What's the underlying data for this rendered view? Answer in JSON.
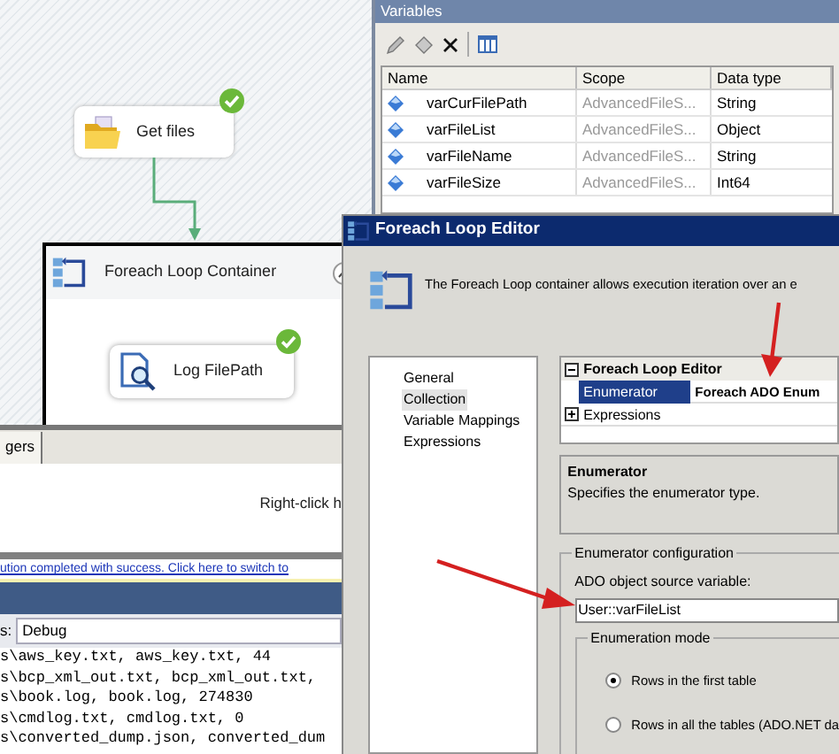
{
  "designer": {
    "task": {
      "label": "Get files",
      "succeeded": true
    },
    "container": {
      "title": "Foreach Loop Container",
      "expanded": true,
      "children": [
        {
          "label": "Log FilePath",
          "succeeded": true
        }
      ]
    }
  },
  "variables": {
    "title": "Variables",
    "columns": [
      "Name",
      "Scope",
      "Data type"
    ],
    "rows": [
      {
        "name": "varCurFilePath",
        "scope": "AdvancedFileS...",
        "type": "String"
      },
      {
        "name": "varFileList",
        "scope": "AdvancedFileS...",
        "type": "Object"
      },
      {
        "name": "varFileName",
        "scope": "AdvancedFileS...",
        "type": "String"
      },
      {
        "name": "varFileSize",
        "scope": "AdvancedFileS...",
        "type": "Int64"
      }
    ]
  },
  "designer_panel": {
    "tab": "gers",
    "hint": "Right-click h",
    "status_link": "ution completed with success. Click here to switch to"
  },
  "output": {
    "label": "s:",
    "source": "Debug",
    "lines": [
      "s\\aws_key.txt, aws_key.txt, 44",
      "s\\bcp_xml_out.txt, bcp_xml_out.txt,",
      "s\\book.log, book.log, 274830",
      "s\\cmdlog.txt, cmdlog.txt, 0",
      "s\\converted_dump.json, converted_dum"
    ]
  },
  "editor": {
    "title": "Foreach Loop Editor",
    "description": "The Foreach Loop container allows execution iteration over an e",
    "pages": [
      {
        "label": "General",
        "selected": false
      },
      {
        "label": "Collection",
        "selected": true
      },
      {
        "label": "Variable Mappings",
        "selected": false
      },
      {
        "label": "Expressions",
        "selected": false
      }
    ],
    "grid": {
      "category": "Foreach Loop Editor",
      "expanded": true,
      "rows": [
        {
          "name": "Enumerator",
          "value": "Foreach ADO Enum",
          "selected": true,
          "kind": "property"
        },
        {
          "name": "Expressions",
          "kind": "category",
          "expanded": false
        }
      ]
    },
    "help": {
      "title": "Enumerator",
      "text": "Specifies the enumerator type."
    },
    "config": {
      "title": "Enumerator configuration",
      "source_label": "ADO object source variable:",
      "source_value": "User::varFileList",
      "mode_title": "Enumeration mode",
      "modes": [
        {
          "label": "Rows in the first table",
          "selected": true
        },
        {
          "label": "Rows in all the tables (ADO.NET da",
          "selected": false
        }
      ]
    }
  }
}
